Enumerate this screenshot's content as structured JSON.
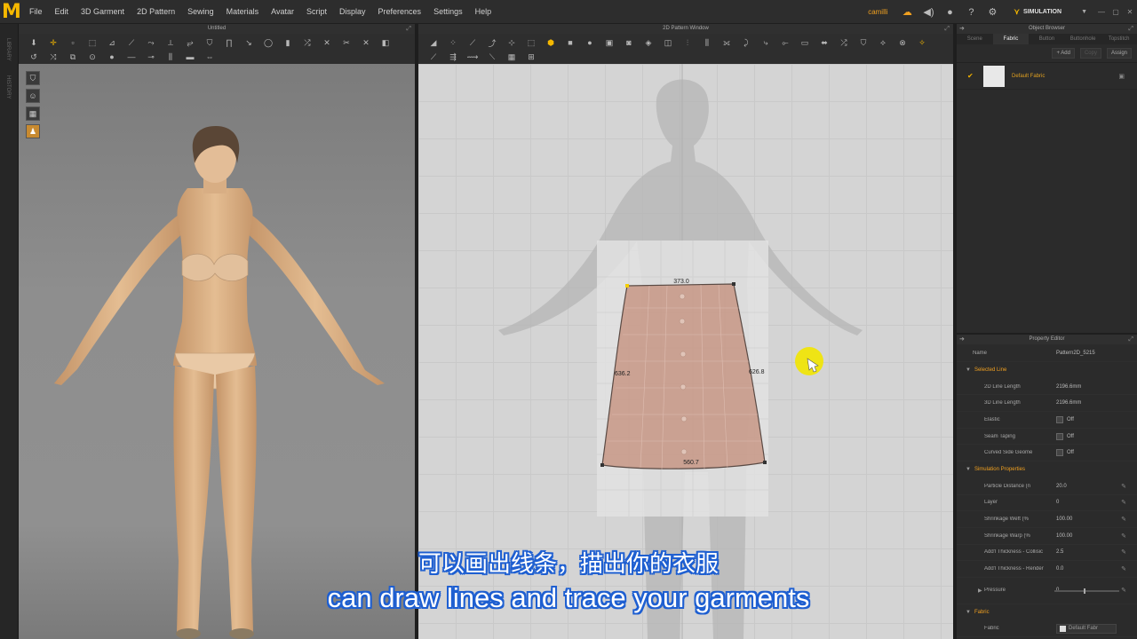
{
  "app": {
    "logo_letter": "M",
    "user": "camilli",
    "mode": "SIMULATION"
  },
  "menu": [
    "File",
    "Edit",
    "3D Garment",
    "2D Pattern",
    "Sewing",
    "Materials",
    "Avatar",
    "Script",
    "Display",
    "Preferences",
    "Settings",
    "Help"
  ],
  "left_strip": {
    "library": "LIBRARY",
    "history": "HISTORY"
  },
  "window3d": {
    "title": "Untitled"
  },
  "window2d": {
    "title": "2D Pattern Window"
  },
  "pattern": {
    "top": "373.0",
    "left": "636.2",
    "right": "626.8",
    "bottom": "560.7"
  },
  "object_browser": {
    "title": "Object Browser",
    "tabs": [
      "Scene",
      "Fabric",
      "Button",
      "Buttonhole",
      "Topstitch"
    ],
    "active_tab": "Fabric",
    "add_label": "+ Add",
    "copy_label": "Copy",
    "assign_label": "Assign",
    "fabric_name": "Default Fabric"
  },
  "property_editor": {
    "title": "Property Editor",
    "name_label": "Name",
    "name_value": "Pattern2D_5215",
    "selected_line": {
      "section": "Selected Line",
      "len2d_label": "2D Line Length",
      "len2d": "2196.6mm",
      "len3d_label": "3D Line Length",
      "len3d": "2196.6mm",
      "elastic_label": "Elastic",
      "elastic": "Off",
      "seam_label": "Seam Taping",
      "seam": "Off",
      "curved_label": "Curved Side Geome",
      "curved": "Off"
    },
    "simulation": {
      "section": "Simulation Properties",
      "particle_label": "Particle Distance (n",
      "particle": "20.0",
      "layer_label": "Layer",
      "layer": "0",
      "weft_label": "Shrinkage Weft (%",
      "weft": "100.00",
      "warp_label": "Shrinkage Warp (%",
      "warp": "100.00",
      "collision_label": "Add'l Thickness - Collisic",
      "collision": "2.5",
      "render_label": "Add'l Thickness - Render",
      "render": "0.0",
      "pressure_label": "Pressure",
      "pressure": "0"
    },
    "fabric": {
      "section": "Fabric",
      "label": "Fabric",
      "value": "Default Fabr"
    }
  },
  "subtitles": {
    "cn": "可以画出线条，描出你的衣服",
    "en": "can draw lines and trace your garments"
  },
  "colors": {
    "accent": "#f5b800",
    "subtitle_outline": "#1e5fd1",
    "garment": "#c79785"
  }
}
